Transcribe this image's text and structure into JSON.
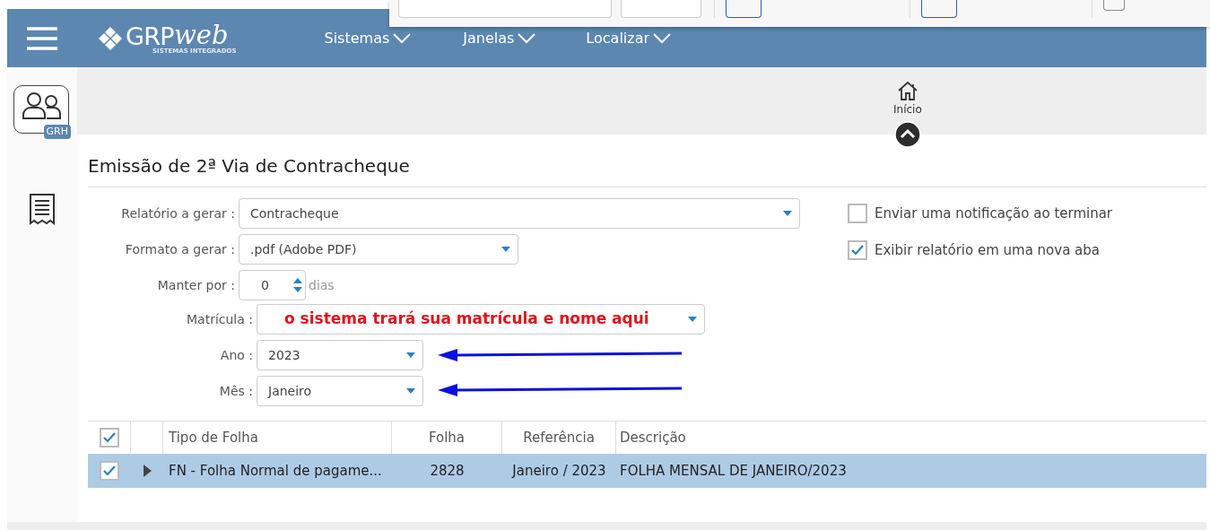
{
  "header": {
    "logo": {
      "name": "GRP",
      "suffix": "web",
      "tagline": "SISTEMAS INTEGRADOS"
    },
    "menus": [
      {
        "label": "Sistemas"
      },
      {
        "label": "Janelas"
      },
      {
        "label": "Localizar"
      }
    ]
  },
  "sidebar": {
    "items": [
      {
        "kind": "app",
        "badge": "GRH"
      },
      {
        "kind": "report"
      }
    ]
  },
  "toolbar": {
    "home": "Início"
  },
  "title": "Emissão de 2ª Via de Contracheque",
  "form": {
    "fields": [
      {
        "kind": "select",
        "label": "Relatório a gerar :",
        "value": "Contracheque",
        "highlighted": false
      },
      {
        "kind": "select",
        "label": "Formato a gerar :",
        "value": ".pdf (Adobe PDF)",
        "highlighted": false
      },
      {
        "kind": "number",
        "label": "Manter por :",
        "value": "0",
        "unit": "dias",
        "highlighted": false
      },
      {
        "kind": "select",
        "label": "Matrícula :",
        "value": "o sistema trará sua matrícula e nome aqui",
        "highlighted": true
      },
      {
        "kind": "select",
        "label": "Ano :",
        "value": "2023",
        "highlighted": false
      },
      {
        "kind": "select",
        "label": "Mês :",
        "value": "Janeiro",
        "highlighted": false
      }
    ],
    "options": [
      {
        "label": "Enviar uma notificação ao terminar",
        "checked": false
      },
      {
        "label": "Exibir relatório em uma nova aba",
        "checked": true
      }
    ]
  },
  "annotations": [
    {
      "kind": "arrow"
    },
    {
      "kind": "arrow"
    }
  ],
  "table": {
    "all_checked": true,
    "columns": [
      "Tipo de Folha",
      "Folha",
      "Referência",
      "Descrição"
    ],
    "rows": [
      {
        "checked": true,
        "selected": true,
        "expanded": false,
        "cells": [
          "FN - Folha Normal de pagame...",
          "2828",
          "Janeiro / 2023",
          "FOLHA MENSAL DE JANEIRO/2023"
        ]
      }
    ]
  }
}
